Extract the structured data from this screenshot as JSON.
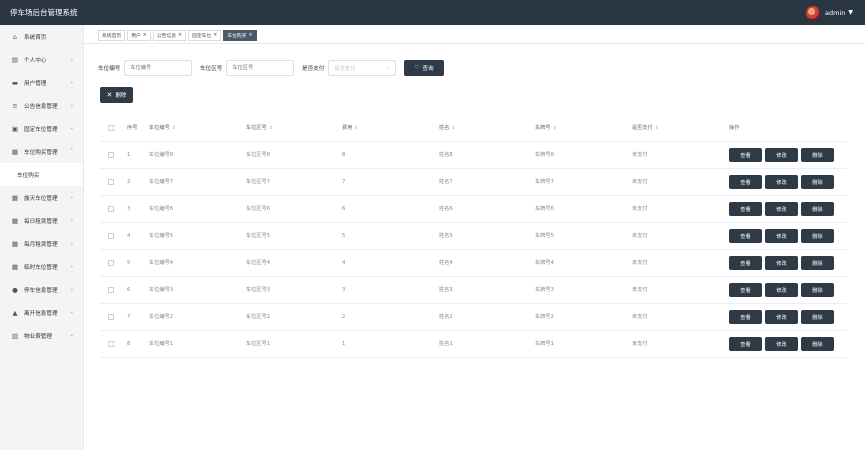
{
  "app": {
    "title": "停车场后台管理系统",
    "user": "admin"
  },
  "sidebar": {
    "items": [
      {
        "label": "系统首页",
        "icon": "home-icon",
        "glyph": "⌂",
        "chevron": false
      },
      {
        "label": "个人中心",
        "icon": "calendar-icon",
        "glyph": "▤",
        "chevron": true
      },
      {
        "label": "用户管理",
        "icon": "monitor-icon",
        "glyph": "▬",
        "chevron": true
      },
      {
        "label": "公告信息管理",
        "icon": "list-icon",
        "glyph": "≡",
        "chevron": true
      },
      {
        "label": "固定车位管理",
        "icon": "message-icon",
        "glyph": "▣",
        "chevron": true
      },
      {
        "label": "车位购买管理",
        "icon": "grid-icon",
        "glyph": "▦",
        "chevron": true,
        "expanded": true
      },
      {
        "label": "车位购买",
        "sub": true
      },
      {
        "label": "露天车位管理",
        "icon": "grid-icon",
        "glyph": "▦",
        "chevron": true
      },
      {
        "label": "每日租赁管理",
        "icon": "grid-icon",
        "glyph": "▦",
        "chevron": true
      },
      {
        "label": "每月租赁管理",
        "icon": "grid-icon",
        "glyph": "▦",
        "chevron": true
      },
      {
        "label": "临时车位管理",
        "icon": "grid-icon",
        "glyph": "▦",
        "chevron": true
      },
      {
        "label": "停车信息管理",
        "icon": "user-icon",
        "glyph": "●",
        "chevron": true
      },
      {
        "label": "离开信息管理",
        "icon": "chart-icon",
        "glyph": "▲",
        "chevron": true
      },
      {
        "label": "物业费管理",
        "icon": "clipboard-icon",
        "glyph": "▥",
        "chevron": true
      }
    ]
  },
  "tabs": [
    {
      "label": "系统首页",
      "closable": false,
      "active": false
    },
    {
      "label": "用户",
      "closable": true,
      "active": false
    },
    {
      "label": "公告信息",
      "closable": true,
      "active": false
    },
    {
      "label": "固定车位",
      "closable": true,
      "active": false
    },
    {
      "label": "车位购买",
      "closable": true,
      "active": true
    }
  ],
  "filters": {
    "slot_no": {
      "label": "车位编号",
      "placeholder": "车位编号"
    },
    "zone": {
      "label": "车位区号",
      "placeholder": "车位区号"
    },
    "paid": {
      "label": "是否支付",
      "placeholder": "是否支付"
    },
    "search_label": "查询"
  },
  "toolbar": {
    "delete_label": "删除"
  },
  "table": {
    "headers": [
      "序号",
      "车位编号",
      "车位区号",
      "费用",
      "姓名",
      "车牌号",
      "是否支付",
      "操作"
    ],
    "rows": [
      [
        "1",
        "车位编号8",
        "车位区号8",
        "8",
        "姓名8",
        "车牌号8",
        "未支付"
      ],
      [
        "2",
        "车位编号7",
        "车位区号7",
        "7",
        "姓名7",
        "车牌号7",
        "未支付"
      ],
      [
        "3",
        "车位编号6",
        "车位区号6",
        "6",
        "姓名6",
        "车牌号6",
        "未支付"
      ],
      [
        "4",
        "车位编号5",
        "车位区号5",
        "5",
        "姓名5",
        "车牌号5",
        "未支付"
      ],
      [
        "5",
        "车位编号4",
        "车位区号4",
        "4",
        "姓名4",
        "车牌号4",
        "未支付"
      ],
      [
        "6",
        "车位编号3",
        "车位区号3",
        "3",
        "姓名3",
        "车牌号3",
        "未支付"
      ],
      [
        "7",
        "车位编号2",
        "车位区号2",
        "2",
        "姓名2",
        "车牌号2",
        "未支付"
      ],
      [
        "8",
        "车位编号1",
        "车位区号1",
        "1",
        "姓名1",
        "车牌号1",
        "未支付"
      ]
    ],
    "actions": [
      "查看",
      "修改",
      "删除"
    ]
  }
}
